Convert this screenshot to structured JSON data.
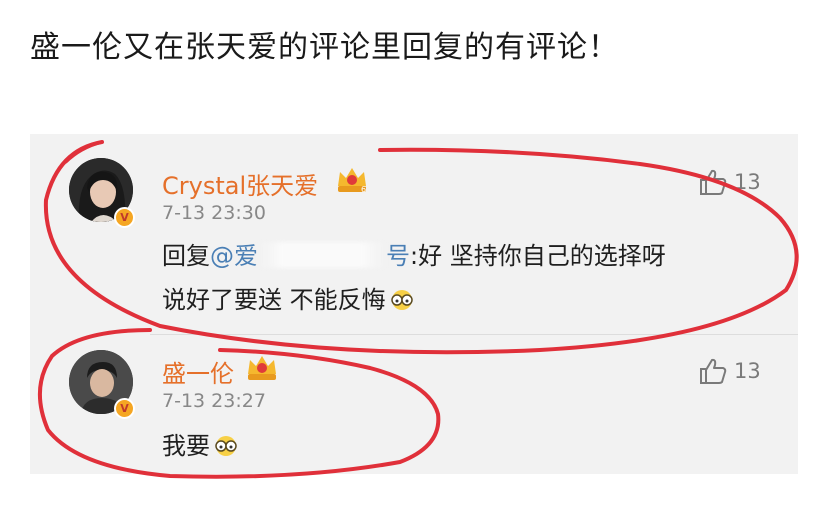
{
  "headline": "盛一伦又在张天爱的评论里回复的有评论！",
  "comments": [
    {
      "username": "Crystal张天爱",
      "time": "7-13 23:30",
      "likes": "13",
      "reply_prefix": "回复",
      "mention_start": "@爱",
      "mention_end": "号",
      "line1_rest": ":好 坚持你自己的选择呀",
      "line2": "说好了要送 不能反悔",
      "verified_badge": "V"
    },
    {
      "username": "盛一伦",
      "time": "7-13 23:27",
      "likes": "13",
      "text": "我要",
      "verified_badge": "V"
    }
  ],
  "icons": {
    "like": "thumbs-up-icon",
    "crown": "crown-badge-icon",
    "emoji": "glasses-emoji-icon"
  },
  "colors": {
    "username": "#e5702a",
    "mention": "#4a7fb5",
    "annotation": "#e0303a",
    "panel": "#f2f2f2"
  }
}
